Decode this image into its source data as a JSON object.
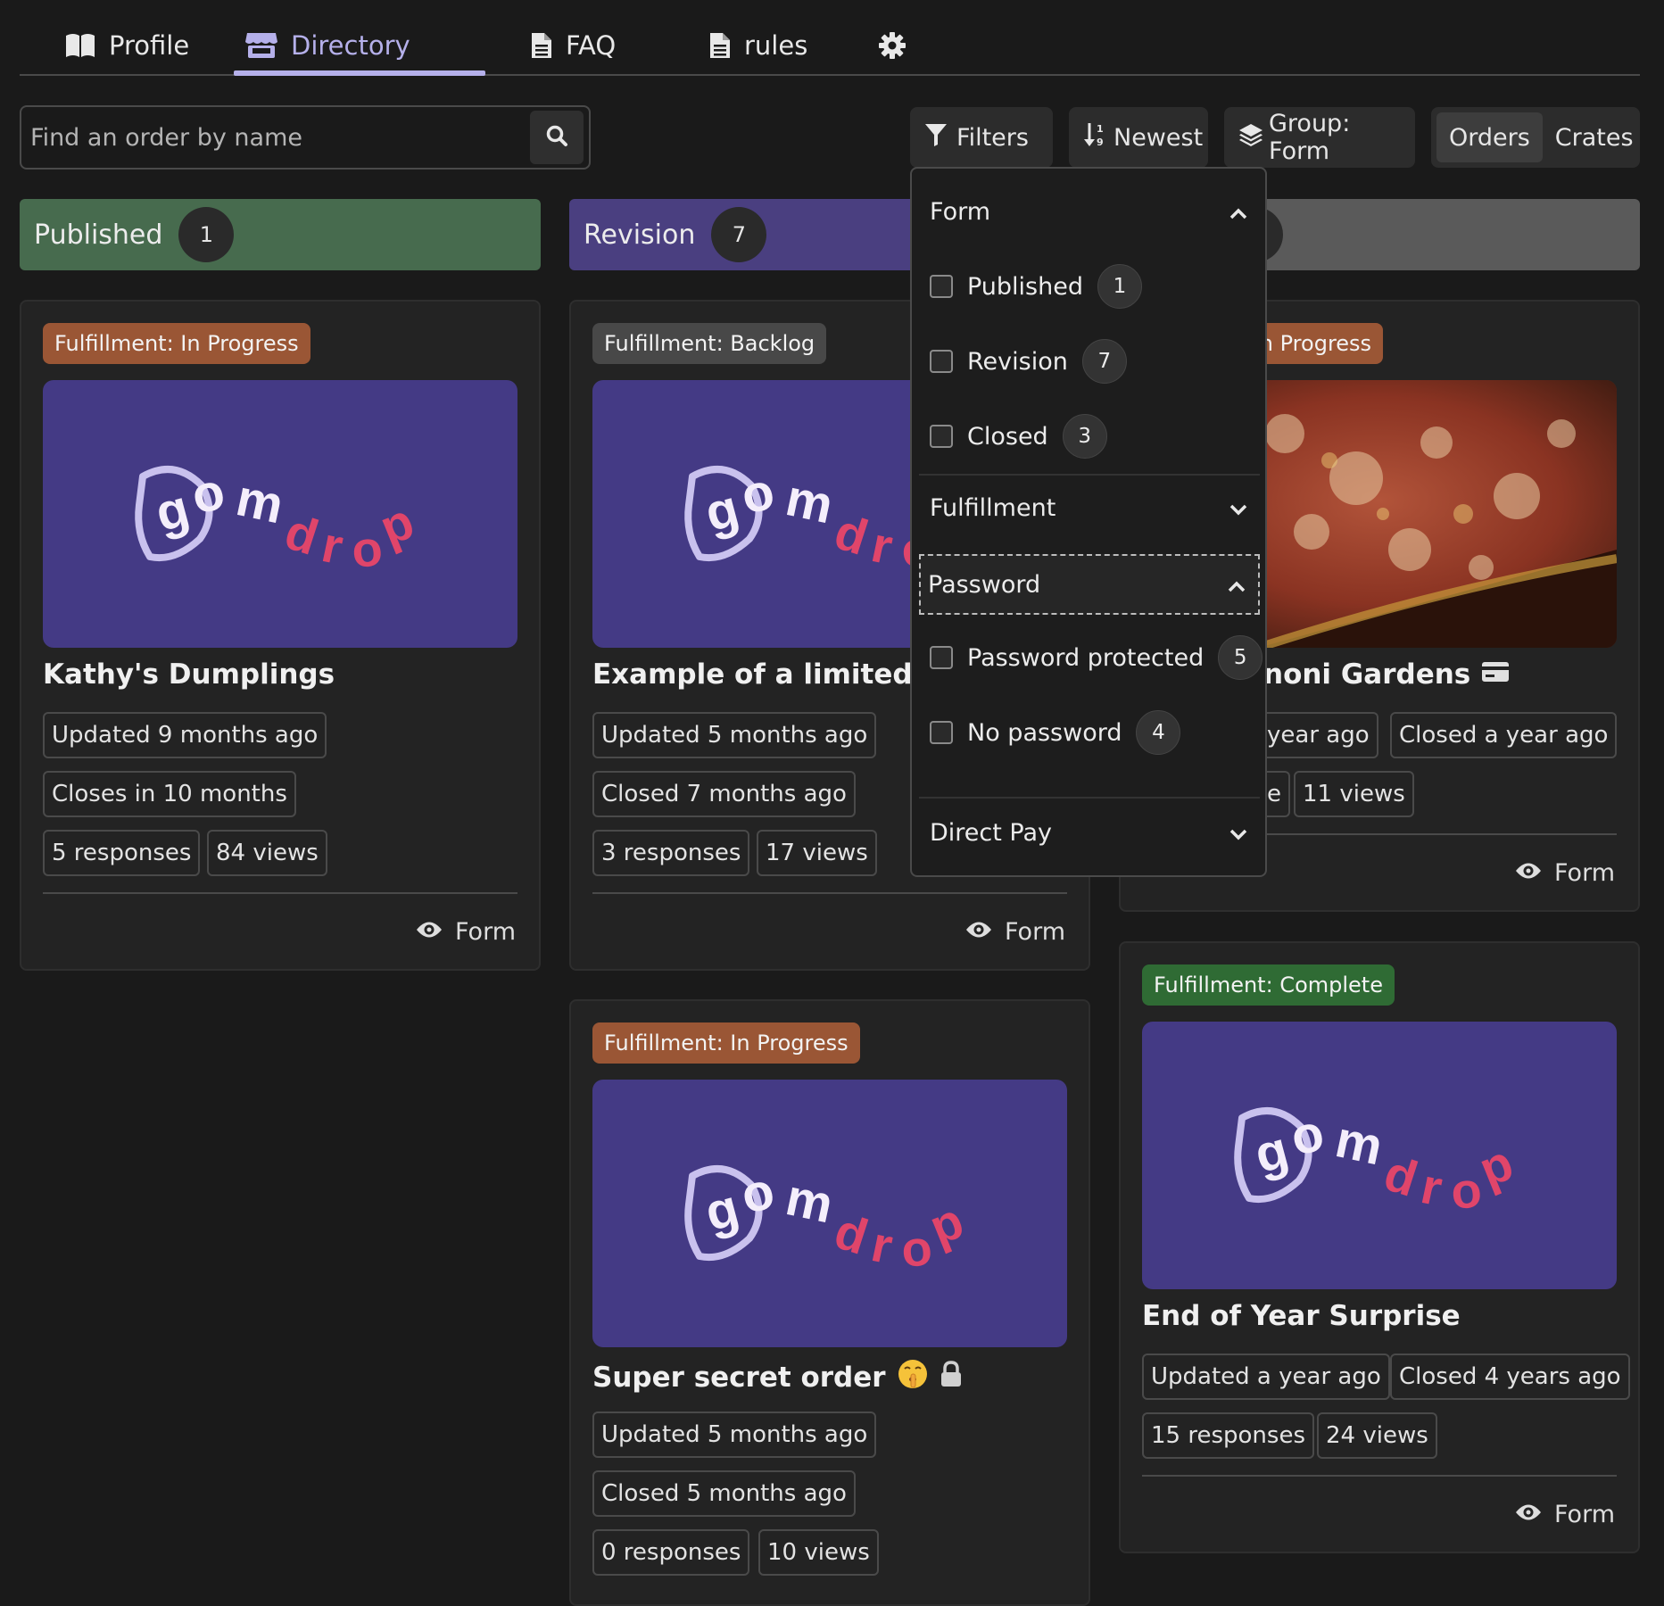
{
  "tabs": [
    {
      "label": "Profile",
      "icon": "book-icon"
    },
    {
      "label": "Directory",
      "icon": "store-icon",
      "active": true
    },
    {
      "label": "FAQ",
      "icon": "document-icon"
    },
    {
      "label": "rules",
      "icon": "document-icon"
    },
    {
      "label": "",
      "icon": "gear-icon"
    }
  ],
  "search": {
    "placeholder": "Find an order by name"
  },
  "toolbar": {
    "filters_label": "Filters",
    "sort_label": "Newest",
    "group_label": "Group: Form",
    "view_options": [
      "Orders",
      "Crates"
    ],
    "view_selected": "Orders"
  },
  "columns": [
    {
      "label": "Published",
      "count": "1",
      "color": "#476b4e"
    },
    {
      "label": "Revision",
      "count": "7",
      "color": "#4a3f80"
    },
    {
      "label": "",
      "count": "",
      "color": "#5a5a5a"
    }
  ],
  "colors": {
    "in_progress": "#9a5635",
    "backlog": "#484848",
    "complete": "#2f6b34",
    "logo_bg": "#443a85",
    "accent": "#b5b0ea"
  },
  "cards": {
    "kathy": {
      "status": "Fulfillment: In Progress",
      "title": "Kathy's Dumplings",
      "updated": "Updated 9 months ago",
      "closes": "Closes in 10 months",
      "responses": "5 responses",
      "views": "84 views",
      "link": "Form"
    },
    "limited": {
      "status": "Fulfillment: Backlog",
      "title": "Example of a limited ord",
      "updated": "Updated 5 months ago",
      "closed": "Closed 7 months ago",
      "responses": "3 responses",
      "views": "17 views",
      "link": "Form"
    },
    "secret": {
      "status": "Fulfillment: In Progress",
      "title": "Super secret order",
      "updated": "Updated 5 months ago",
      "closed": "Closed 5 months ago",
      "responses": "0 responses",
      "views": "10 views"
    },
    "gardens": {
      "status": ": In Progress",
      "title": "noni Gardens",
      "updated": "year ago",
      "closed": "Closed a year ago",
      "responses": "e",
      "views": "11 views",
      "link": "Form"
    },
    "surprise": {
      "status": "Fulfillment: Complete",
      "title": "End of Year Surprise",
      "updated": "Updated a year ago",
      "closed": "Closed 4 years ago",
      "responses": "15 responses",
      "views": "24 views",
      "link": "Form"
    }
  },
  "logo": {
    "text1": "gom",
    "text2": "drop"
  },
  "filters": {
    "form": {
      "label": "Form",
      "items": [
        {
          "label": "Published",
          "count": "1"
        },
        {
          "label": "Revision",
          "count": "7"
        },
        {
          "label": "Closed",
          "count": "3"
        }
      ]
    },
    "fulfillment": {
      "label": "Fulfillment"
    },
    "password": {
      "label": "Password",
      "items": [
        {
          "label": "Password protected",
          "count": "5"
        },
        {
          "label": "No password",
          "count": "4"
        }
      ]
    },
    "direct_pay": {
      "label": "Direct Pay"
    }
  }
}
